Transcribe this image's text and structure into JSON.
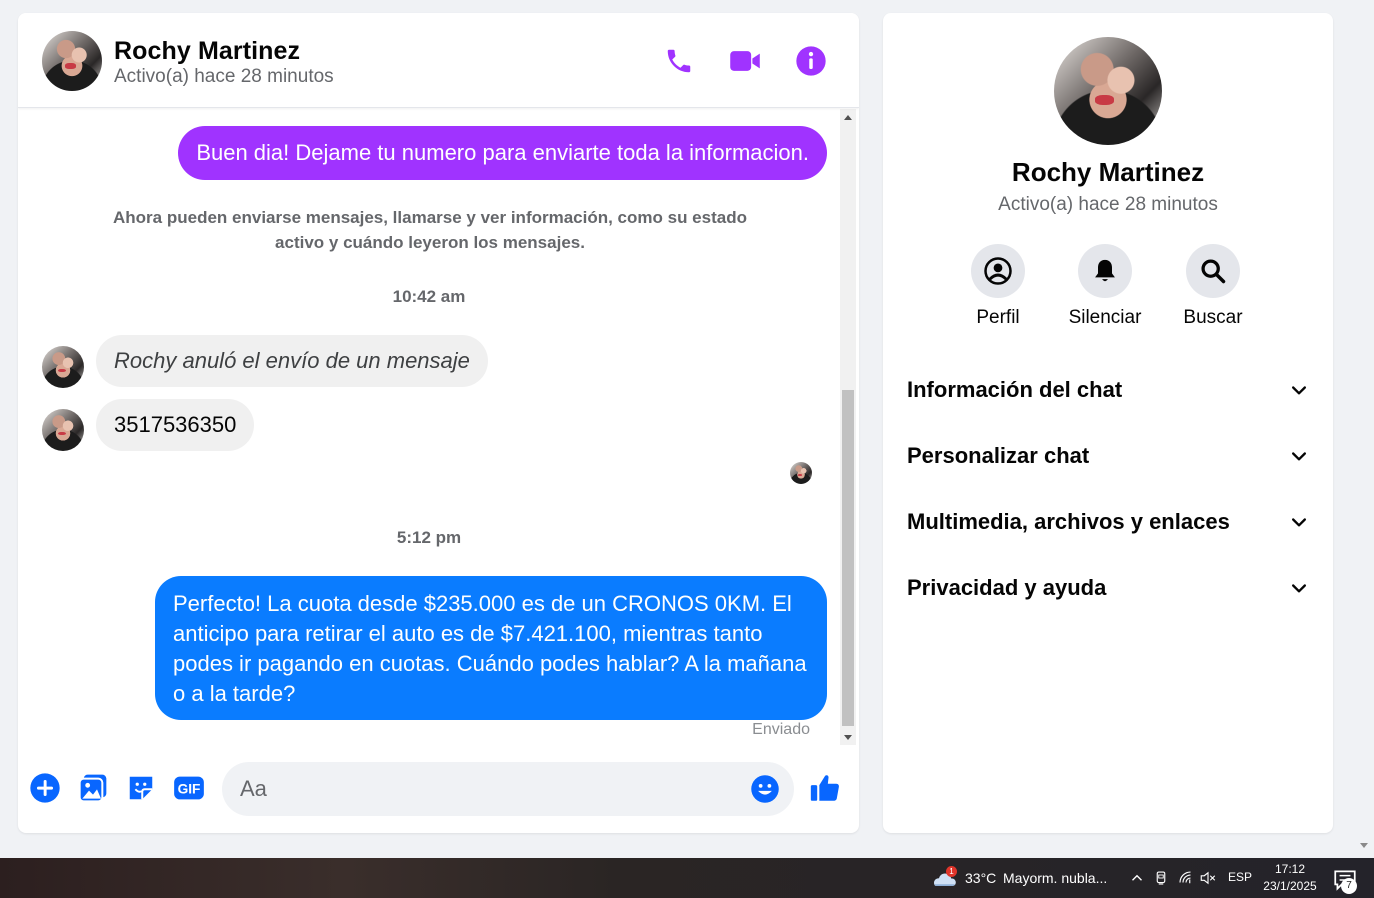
{
  "chat": {
    "contact_name": "Rochy Martinez",
    "contact_status": "Activo(a) hace 28 minutos",
    "messages": {
      "outgoing_1": "Buen dia! Dejame tu numero para enviarte toda la informacion.",
      "system_note": "Ahora pueden enviarse mensajes, llamarse y ver información, como su estado activo y cuándo leyeron los mensajes.",
      "timestamp_1": "10:42 am",
      "incoming_unsent": "Rochy anuló el envío de un mensaje",
      "incoming_number": "3517536350",
      "timestamp_2": "5:12 pm",
      "outgoing_2": "Perfecto! La cuota desde $235.000 es de un CRONOS 0KM. El anticipo para retirar el auto es de $7.421.100, mientras tanto podes ir pagando en cuotas. Cuándo podes hablar? A la mañana o a la tarde?",
      "sent_status": "Enviado"
    },
    "composer": {
      "placeholder": "Aa"
    }
  },
  "info_panel": {
    "name": "Rochy Martinez",
    "status": "Activo(a) hace 28 minutos",
    "actions": [
      "Perfil",
      "Silenciar",
      "Buscar"
    ],
    "sections": [
      "Información del chat",
      "Personalizar chat",
      "Multimedia, archivos y enlaces",
      "Privacidad y ayuda"
    ]
  },
  "taskbar": {
    "weather_badge": "1",
    "temperature": "33°C",
    "condition": "Mayorm. nubla...",
    "language": "ESP",
    "time": "17:12",
    "date": "23/1/2025",
    "notification_count": "7"
  },
  "colors": {
    "accent_purple": "#a033ff",
    "messenger_blue": "#0a7cff",
    "icon_blue": "#0866ff",
    "header_icon_purple": "#a033ff"
  },
  "icons": {
    "header": [
      "phone-icon",
      "video-camera-icon",
      "info-icon"
    ],
    "composer": [
      "plus-icon",
      "gallery-icon",
      "sticker-icon",
      "gif-icon",
      "emoji-icon",
      "thumbs-up-icon"
    ],
    "actions": [
      "profile-icon",
      "bell-icon",
      "search-icon"
    ]
  }
}
